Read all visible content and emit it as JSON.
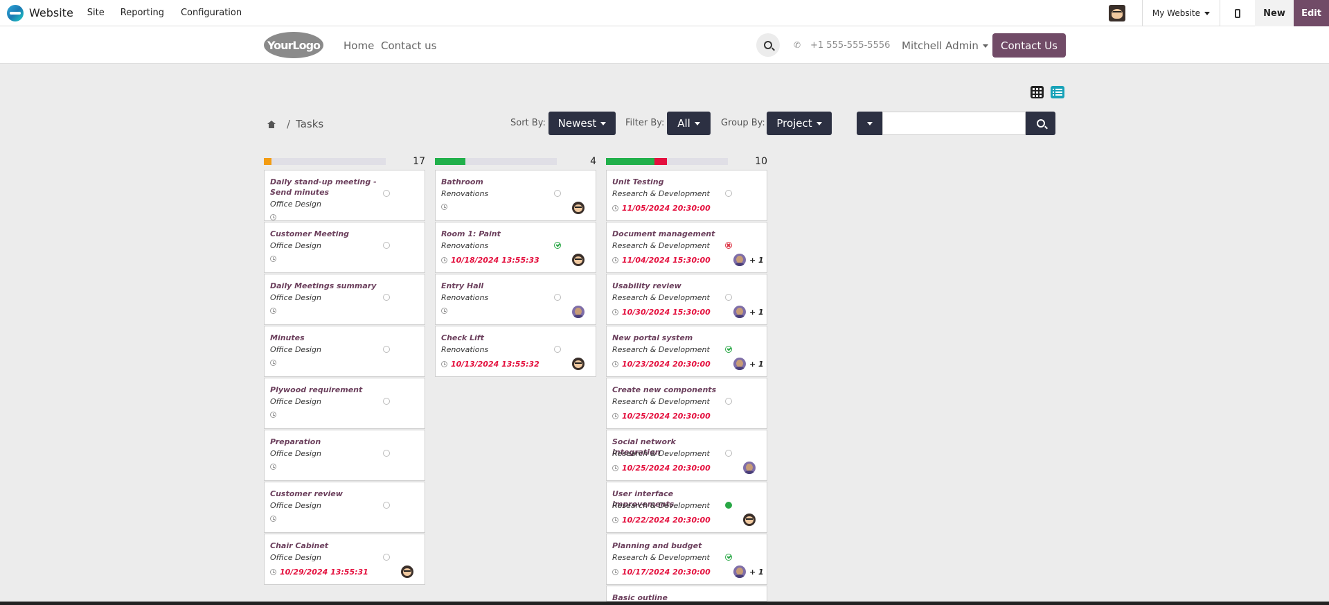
{
  "admin_bar": {
    "app_name": "Website",
    "menu": [
      "Site",
      "Reporting",
      "Configuration"
    ],
    "site_switcher": "My Website",
    "new_label": "New",
    "edit_label": "Edit"
  },
  "header": {
    "logo_text": "YourLogo",
    "nav": [
      "Home",
      "Contact us"
    ],
    "phone": "+1 555-555-5556",
    "user": "Mitchell Admin",
    "contact_button": "Contact Us"
  },
  "breadcrumb": {
    "current": "Tasks",
    "separator": "/"
  },
  "toolbar": {
    "sort_label": "Sort By:",
    "sort_value": "Newest",
    "filter_label": "Filter By:",
    "filter_value": "All",
    "group_label": "Group By:",
    "group_value": "Project",
    "search_value": ""
  },
  "colors": {
    "brand": "#714b67",
    "dark_button": "#2c3042",
    "task_title": "#6b3f5c",
    "deadline": "#e4103e",
    "progress_done": "#21b04b",
    "progress_blocked": "#e4103e",
    "progress_warning": "#f39c12"
  },
  "columns": [
    {
      "count": "17",
      "progress": [
        {
          "color": "#f39c12",
          "fraction": 0.06
        }
      ],
      "cards": [
        {
          "title": "Daily stand-up meeting - Send minutes",
          "project": "Office Design",
          "date": "",
          "status": "normal",
          "avatar": "",
          "plus": ""
        },
        {
          "title": "Customer Meeting",
          "project": "Office Design",
          "date": "",
          "status": "normal",
          "avatar": "",
          "plus": ""
        },
        {
          "title": "Daily Meetings summary",
          "project": "Office Design",
          "date": "",
          "status": "normal",
          "avatar": "",
          "plus": ""
        },
        {
          "title": "Minutes",
          "project": "Office Design",
          "date": "",
          "status": "normal",
          "avatar": "",
          "plus": ""
        },
        {
          "title": "Plywood requirement",
          "project": "Office Design",
          "date": "",
          "status": "normal",
          "avatar": "",
          "plus": ""
        },
        {
          "title": "Preparation",
          "project": "Office Design",
          "date": "",
          "status": "normal",
          "avatar": "",
          "plus": ""
        },
        {
          "title": "Customer review",
          "project": "Office Design",
          "date": "",
          "status": "normal",
          "avatar": "",
          "plus": ""
        },
        {
          "title": "Chair Cabinet",
          "project": "Office Design",
          "date": "10/29/2024 13:55:31",
          "status": "normal",
          "avatar": "a",
          "plus": ""
        }
      ]
    },
    {
      "count": "4",
      "progress": [
        {
          "color": "#21b04b",
          "fraction": 0.25
        }
      ],
      "cards": [
        {
          "title": "Bathroom",
          "project": "Renovations",
          "date": "",
          "status": "normal",
          "avatar": "a",
          "plus": ""
        },
        {
          "title": "Room 1: Paint",
          "project": "Renovations",
          "date": "10/18/2024 13:55:33",
          "status": "done",
          "avatar": "a",
          "plus": ""
        },
        {
          "title": "Entry Hall",
          "project": "Renovations",
          "date": "",
          "status": "normal",
          "avatar": "b",
          "plus": ""
        },
        {
          "title": "Check Lift",
          "project": "Renovations",
          "date": "10/13/2024 13:55:32",
          "status": "normal",
          "avatar": "a",
          "plus": ""
        }
      ]
    },
    {
      "count": "10",
      "progress": [
        {
          "color": "#21b04b",
          "fraction": 0.4
        },
        {
          "color": "#e4103e",
          "fraction": 0.1
        }
      ],
      "cards": [
        {
          "title": "Unit Testing",
          "project": "Research & Development",
          "date": "11/05/2024 20:30:00",
          "status": "normal",
          "avatar": "",
          "plus": ""
        },
        {
          "title": "Document management",
          "project": "Research & Development",
          "date": "11/04/2024 15:30:00",
          "status": "blocked",
          "avatar": "b",
          "plus": "+ 1"
        },
        {
          "title": "Usability review",
          "project": "Research & Development",
          "date": "10/30/2024 15:30:00",
          "status": "normal",
          "avatar": "b",
          "plus": "+ 1"
        },
        {
          "title": "New portal system",
          "project": "Research & Development",
          "date": "10/23/2024 20:30:00",
          "status": "done",
          "avatar": "b",
          "plus": "+ 1"
        },
        {
          "title": "Create new components",
          "project": "Research & Development",
          "date": "10/25/2024 20:30:00",
          "status": "normal",
          "avatar": "",
          "plus": ""
        },
        {
          "title": "Social network integration",
          "project": "Research & Development",
          "date": "10/25/2024 20:30:00",
          "status": "normal",
          "avatar": "b",
          "plus": ""
        },
        {
          "title": "User interface improvements",
          "project": "Research & Development",
          "date": "10/22/2024 20:30:00",
          "status": "green",
          "avatar": "a",
          "plus": ""
        },
        {
          "title": "Planning and budget",
          "project": "Research & Development",
          "date": "10/17/2024 20:30:00",
          "status": "done",
          "avatar": "b",
          "plus": "+ 1"
        },
        {
          "title": "Basic outline",
          "project": "",
          "date": "",
          "status": "none",
          "avatar": "",
          "plus": ""
        }
      ]
    }
  ]
}
